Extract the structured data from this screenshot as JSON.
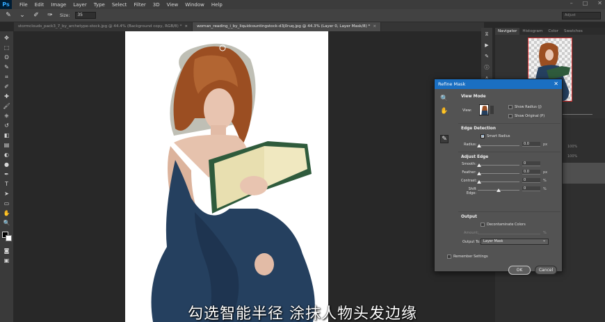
{
  "app": {
    "logo": "Ps",
    "menu": [
      "File",
      "Edit",
      "Image",
      "Layer",
      "Type",
      "Select",
      "Filter",
      "3D",
      "View",
      "Window",
      "Help"
    ],
    "window_controls": [
      "–",
      "□",
      "✕"
    ]
  },
  "options_bar": {
    "size_label": "Size:",
    "size_value": "35",
    "search_placeholder": "Adjust"
  },
  "tabs": [
    {
      "label": "stormclouds_pack3_7_by_archetype-stock.jpg @ 44.4% (Background copy, RGB/8) *",
      "active": false
    },
    {
      "label": "woman_reading_i_by_liquidcountingstock-d3j0ruq.jpg @ 44.3% (Layer 0, Layer Mask/8) *",
      "active": true
    }
  ],
  "toolbar": {
    "icons": [
      "move-icon",
      "marquee-icon",
      "lasso-icon",
      "quick-select-icon",
      "crop-icon",
      "eyedropper-icon",
      "healing-icon",
      "brush-icon",
      "stamp-icon",
      "history-brush-icon",
      "eraser-icon",
      "gradient-icon",
      "blur-icon",
      "dodge-icon",
      "pen-icon",
      "type-icon",
      "path-select-icon",
      "shape-icon",
      "hand-icon",
      "zoom-icon"
    ],
    "glyphs": [
      "✥",
      "⬚",
      "ʘ",
      "✎",
      "⌗",
      "✐",
      "✚",
      "🖌",
      "⎈",
      "↺",
      "◧",
      "▤",
      "◐",
      "●",
      "✒",
      "T",
      "➤",
      "▭",
      "✋",
      "🔍"
    ]
  },
  "navigator": {
    "tabs": [
      "Navigator",
      "Histogram",
      "Color",
      "Swatches"
    ]
  },
  "layers_panel": {
    "opacity_value": "100%",
    "fill_value": "100%"
  },
  "dialog": {
    "title": "Refine Mask",
    "view_mode": {
      "title": "View Mode",
      "view_label": "View:",
      "show_radius": "Show Radius (J)",
      "show_original": "Show Original (P)"
    },
    "edge_detection": {
      "title": "Edge Detection",
      "smart_radius": "Smart Radius",
      "smart_radius_checked": true,
      "radius_label": "Radius:",
      "radius_value": "0.0",
      "radius_unit": "px"
    },
    "adjust_edge": {
      "title": "Adjust Edge",
      "rows": [
        {
          "label": "Smooth:",
          "value": "0",
          "unit": ""
        },
        {
          "label": "Feather:",
          "value": "0.0",
          "unit": "px"
        },
        {
          "label": "Contrast:",
          "value": "0",
          "unit": "%"
        },
        {
          "label": "Shift Edge:",
          "value": "0",
          "unit": "%"
        }
      ]
    },
    "output": {
      "title": "Output",
      "decontaminate": "Decontaminate Colors",
      "amount_label": "Amount:",
      "amount_unit": "%",
      "output_to_label": "Output To:",
      "output_to_value": "Layer Mask"
    },
    "remember": "Remember Settings",
    "ok": "OK",
    "cancel": "Cancel"
  },
  "subtitle": "勾选智能半径 涂抹人物头发边缘",
  "colors": {
    "dialog_title_bar": "#1a6fc2",
    "dress": "#25405f",
    "hair": "#9b4e22",
    "book_cover": "#2f5b3c"
  }
}
